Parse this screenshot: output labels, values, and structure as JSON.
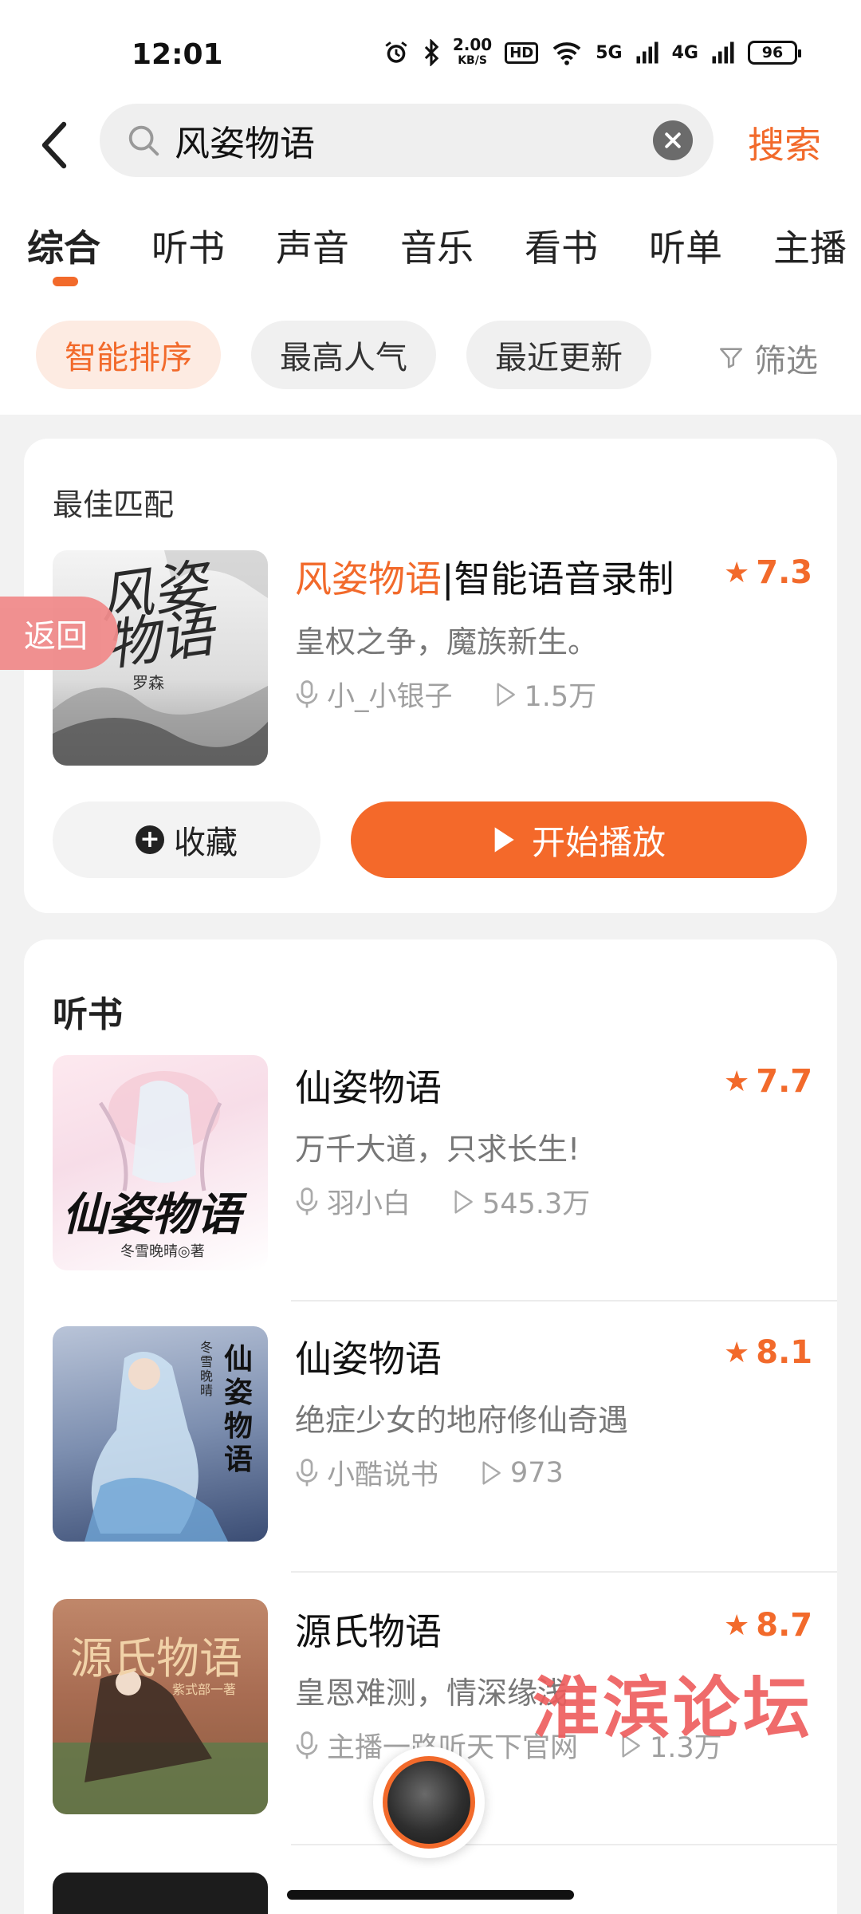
{
  "status_bar": {
    "time": "12:01",
    "net_speed": "2.00",
    "net_speed_unit": "KB/S",
    "hd_badge": "HD",
    "net_5g": "5G",
    "net_4g": "4G",
    "battery": "96",
    "icons": [
      "alarm-icon",
      "bluetooth-icon",
      "wifi-icon",
      "signal-icon",
      "battery-icon"
    ]
  },
  "search": {
    "query": "风姿物语",
    "search_button": "搜索"
  },
  "tabs": [
    "综合",
    "听书",
    "声音",
    "音乐",
    "看书",
    "听单",
    "主播"
  ],
  "sort_chips": [
    "智能排序",
    "最高人气",
    "最近更新"
  ],
  "filter_label": "筛选",
  "floating_back": "返回",
  "best_match": {
    "section_title": "最佳匹配",
    "title_highlight": "风姿物语",
    "title_rest": "|智能语音录制",
    "rating": "7.3",
    "description": "皇权之争，魔族新生。",
    "anchor": "小_小银子",
    "plays": "1.5万",
    "cover_author": "罗森",
    "cover_title": "风姿物语",
    "collect_button": "收藏",
    "play_button": "开始播放"
  },
  "audiobooks": {
    "section_title": "听书",
    "items": [
      {
        "title": "仙姿物语",
        "rating": "7.7",
        "description": "万千大道，只求长生!",
        "anchor": "羽小白",
        "plays": "545.3万",
        "cover_title": "仙姿物语",
        "cover_author": "冬雪晚晴◎著"
      },
      {
        "title": "仙姿物语",
        "rating": "8.1",
        "description": "绝症少女的地府修仙奇遇",
        "anchor": "小酷说书",
        "plays": "973",
        "cover_title": "仙姿物语",
        "cover_author": "冬雪晚晴"
      },
      {
        "title": "源氏物语",
        "rating": "8.7",
        "description": "皇恩难测，情深缘浅",
        "anchor": "主播一路听天下官网",
        "plays": "1.3万",
        "cover_title": "源氏物语",
        "cover_author": "紫式部一著"
      }
    ]
  },
  "watermark": "淮滨论坛",
  "colors": {
    "accent": "#f26a2b",
    "accent_bg": "#fdebe2",
    "background": "#f2f2f2"
  }
}
